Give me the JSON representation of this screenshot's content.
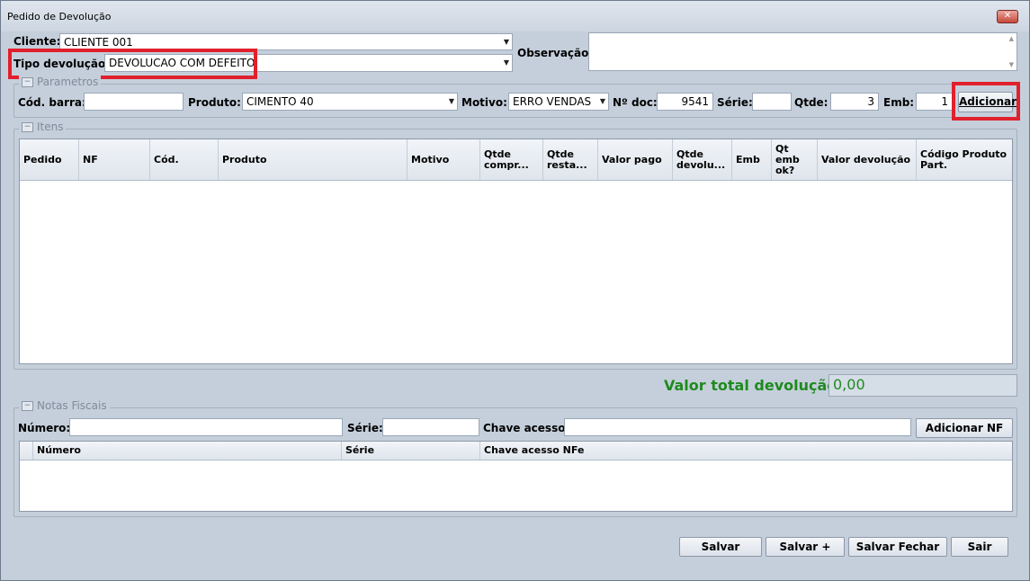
{
  "window": {
    "title": "Pedido de Devolução",
    "close_glyph": "✕"
  },
  "header": {
    "cliente_label": "Cliente:",
    "cliente_value": "CLIENTE 001",
    "tipo_label": "Tipo devolução:",
    "tipo_value": "DEVOLUCAO COM DEFEITO",
    "observacao_label": "Observação:",
    "observacao_value": ""
  },
  "parametros": {
    "title": "Parametros",
    "cod_barra_label": "Cód. barra:",
    "cod_barra_value": "",
    "produto_label": "Produto:",
    "produto_value": "CIMENTO 40",
    "motivo_label": "Motivo:",
    "motivo_value": "ERRO VENDAS",
    "ndoc_label": "Nº doc:",
    "ndoc_value": "9541",
    "serie_label": "Série:",
    "serie_value": "",
    "qtde_label": "Qtde:",
    "qtde_value": "3",
    "emb_label": "Emb:",
    "emb_value": "1",
    "adicionar_label": "Adicionar"
  },
  "itens": {
    "title": "Itens",
    "columns": [
      "Pedido",
      "NF",
      "Cód.",
      "Produto",
      "Motivo",
      "Qtde compr...",
      "Qtde resta...",
      "Valor pago",
      "Qtde devolu...",
      "Emb",
      "Qt emb ok?",
      "Valor devolução",
      "Código Produto Part."
    ]
  },
  "total": {
    "label": "Valor total devolução:",
    "value": "0,00"
  },
  "notas": {
    "title": "Notas Fiscais",
    "numero_label": "Número:",
    "numero_value": "",
    "serie_label": "Série:",
    "serie_value": "",
    "chave_label": "Chave acesso:",
    "chave_value": "",
    "adicionar_nf_label": "Adicionar NF",
    "columns": [
      "Número",
      "Série",
      "Chave acesso NFe"
    ]
  },
  "footer": {
    "salvar": "Salvar",
    "salvar_mais": "Salvar +",
    "salvar_fechar": "Salvar Fechar",
    "sair": "Sair"
  },
  "colors": {
    "highlight": "#e0202c",
    "total_green": "#1f8a1f"
  }
}
